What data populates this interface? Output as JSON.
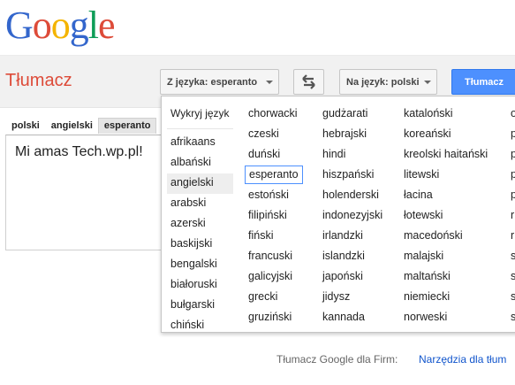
{
  "logo": {
    "letters": [
      "G",
      "o",
      "o",
      "g",
      "l",
      "e"
    ],
    "colors": [
      "#3366cc",
      "#dd4b39",
      "#f4b400",
      "#3366cc",
      "#0f9d58",
      "#dd4b39"
    ]
  },
  "app_title": "Tłumacz",
  "toolbar": {
    "source_label": "Z języka: esperanto",
    "target_label": "Na język: polski",
    "translate_label": "Tłumacz",
    "accent": "#4d90fe"
  },
  "source_tabs": [
    "polski",
    "angielski",
    "esperanto"
  ],
  "input_text": "Mi amas Tech.wp.pl!",
  "dropdown": {
    "detect": "Wykryj język",
    "selected": "esperanto",
    "columns": [
      [
        "afrikaans",
        "albański",
        "angielski",
        "arabski",
        "azerski",
        "baskijski",
        "bengalski",
        "białoruski",
        "bułgarski",
        "chiński"
      ],
      [
        "chorwacki",
        "czeski",
        "duński",
        "esperanto",
        "estoński",
        "filipiński",
        "fiński",
        "francuski",
        "galicyjski",
        "grecki",
        "gruziński"
      ],
      [
        "gudżarati",
        "hebrajski",
        "hindi",
        "hiszpański",
        "holenderski",
        "indonezyjski",
        "irlandzki",
        "islandzki",
        "japoński",
        "jidysz",
        "kannada"
      ],
      [
        "kataloński",
        "koreański",
        "kreolski haitański",
        "litewski",
        "łacina",
        "łotewski",
        "macedoński",
        "malajski",
        "maltański",
        "niemiecki",
        "norweski"
      ],
      [
        "o",
        "p",
        "p",
        "p",
        "p",
        "r",
        "r",
        "s",
        "s",
        "s",
        "s"
      ]
    ]
  },
  "footer": {
    "business": "Tłumacz Google dla Firm:",
    "tools_link": "Narzędzia dla tłum"
  }
}
